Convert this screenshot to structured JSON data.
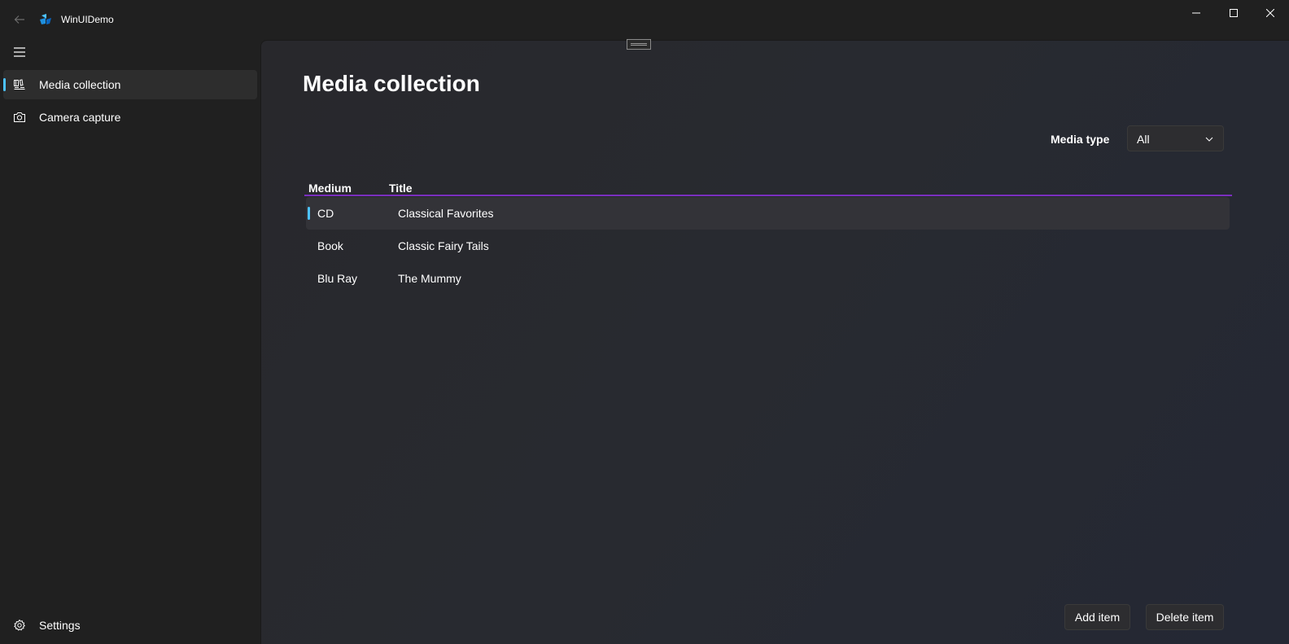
{
  "app": {
    "title": "WinUIDemo"
  },
  "nav": {
    "items": [
      {
        "label": "Media collection",
        "icon": "media-library-icon",
        "selected": true
      },
      {
        "label": "Camera capture",
        "icon": "camera-icon",
        "selected": false
      }
    ],
    "settings_label": "Settings"
  },
  "page": {
    "title": "Media collection",
    "filter": {
      "label": "Media type",
      "value": "All"
    },
    "table": {
      "headers": {
        "medium": "Medium",
        "title": "Title"
      },
      "rows": [
        {
          "medium": "CD",
          "title": "Classical Favorites",
          "selected": true
        },
        {
          "medium": "Book",
          "title": "Classic Fairy Tails",
          "selected": false
        },
        {
          "medium": "Blu Ray",
          "title": "The Mummy",
          "selected": false
        }
      ]
    },
    "actions": {
      "add_label": "Add item",
      "delete_label": "Delete item"
    }
  },
  "colors": {
    "accent": "#4cc2ff",
    "header_underline": "#7b2fbf",
    "window_background": "#202020"
  }
}
